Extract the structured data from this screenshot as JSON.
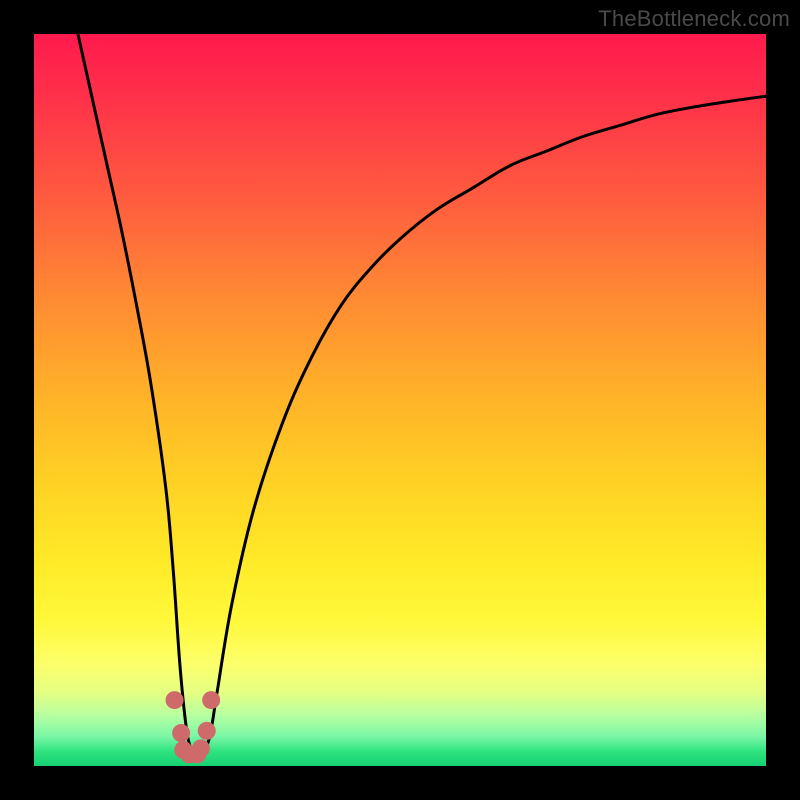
{
  "watermark": {
    "text": "TheBottleneck.com"
  },
  "chart_data": {
    "type": "line",
    "title": "",
    "xlabel": "",
    "ylabel": "",
    "xlim": [
      0,
      100
    ],
    "ylim": [
      0,
      100
    ],
    "grid": false,
    "legend": false,
    "series": [
      {
        "name": "curve",
        "x": [
          6,
          8,
          10,
          12,
          14,
          16,
          18,
          19,
          20,
          21,
          22,
          23,
          24,
          25,
          27,
          30,
          34,
          38,
          42,
          46,
          50,
          55,
          60,
          65,
          70,
          75,
          80,
          85,
          90,
          95,
          100
        ],
        "y": [
          100,
          91,
          82,
          73,
          63,
          52,
          38,
          27,
          13,
          4,
          2,
          2,
          4,
          10,
          22,
          35,
          47,
          56,
          63,
          68,
          72,
          76,
          79,
          82,
          84,
          86,
          87.5,
          89,
          90,
          90.8,
          91.5
        ]
      }
    ],
    "markers": {
      "name": "valley-markers",
      "color": "#cf6a6a",
      "points_x": [
        19.2,
        20.1,
        20.4,
        21.2,
        22.3,
        22.8,
        23.6,
        24.2
      ],
      "points_y": [
        9,
        4.5,
        2.2,
        1.6,
        1.6,
        2.4,
        4.8,
        9
      ]
    }
  }
}
